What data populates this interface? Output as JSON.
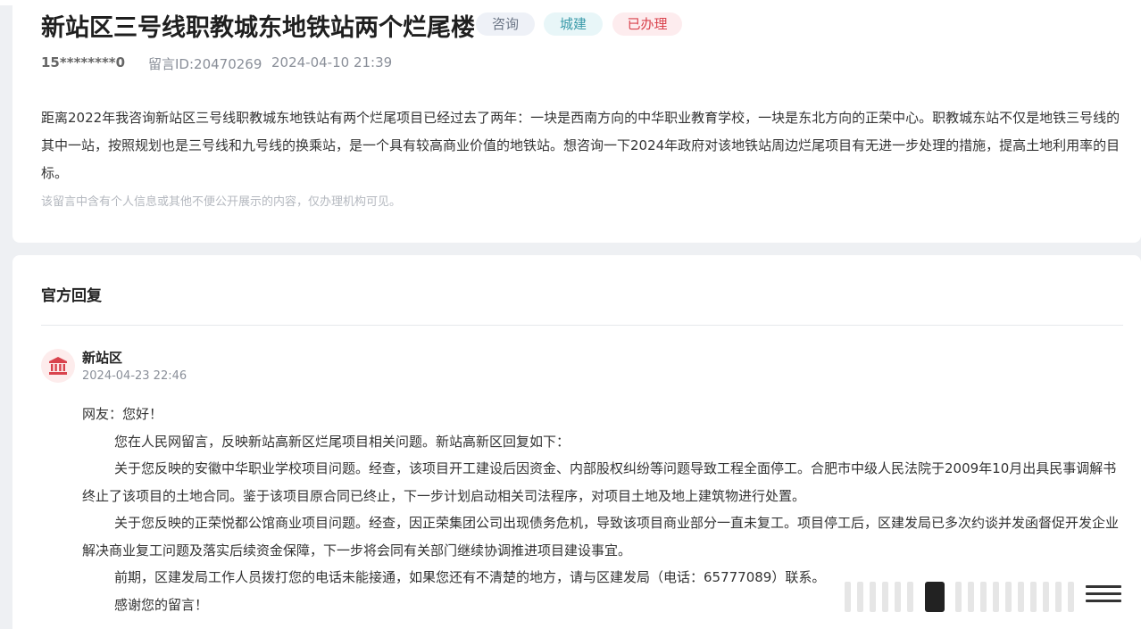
{
  "message": {
    "title": "新站区三号线职教城东地铁站两个烂尾楼",
    "tags": {
      "consult": "咨询",
      "category": "城建",
      "status": "已办理"
    },
    "user": "15********0",
    "message_id": "留言ID:20470269",
    "datetime": "2024-04-10 21:39",
    "content": "距离2022年我咨询新站区三号线职教城东地铁站有两个烂尾项目已经过去了两年：一块是西南方向的中华职业教育学校，一块是东北方向的正荣中心。职教城东站不仅是地铁三号线的其中一站，按照规划也是三号线和九号线的换乘站，是一个具有较高商业价值的地铁站。想咨询一下2024年政府对该地铁站周边烂尾项目有无进一步处理的措施，提高土地利用率的目标。",
    "notice": "该留言中含有个人信息或其他不便公开展示的内容，仅办理机构可见。"
  },
  "reply": {
    "heading": "官方回复",
    "department": "新站区",
    "datetime": "2024-04-23 22:46",
    "greeting": "网友：您好！",
    "paragraphs": [
      "您在人民网留言，反映新站高新区烂尾项目相关问题。新站高新区回复如下：",
      "关于您反映的安徽中华职业学校项目问题。经查，该项目开工建设后因资金、内部股权纠纷等问题导致工程全面停工。合肥市中级人民法院于2009年10月出具民事调解书终止了该项目的土地合同。鉴于该项目原合同已终止，下一步计划启动相关司法程序，对项目土地及地上建筑物进行处置。",
      "关于您反映的正荣悦都公馆商业项目问题。经查，因正荣集团公司出现债务危机，导致该项目商业部分一直未复工。项目停工后，区建发局已多次约谈并发函督促开发企业解决商业复工问题及落实后续资金保障，下一步将会同有关部门继续协调推进项目建设事宜。",
      "前期，区建发局工作人员拨打您的电话未能接通，如果您还有不清楚的地方，请与区建发局（电话：65777089）联系。",
      "感谢您的留言！"
    ]
  },
  "colors": {
    "tag_consult": "#6b7585",
    "tag_category": "#3a9aa9",
    "tag_status": "#d9434d",
    "avatar_icon": "#d9434d"
  },
  "icons": {
    "avatar": "government-building-icon"
  }
}
